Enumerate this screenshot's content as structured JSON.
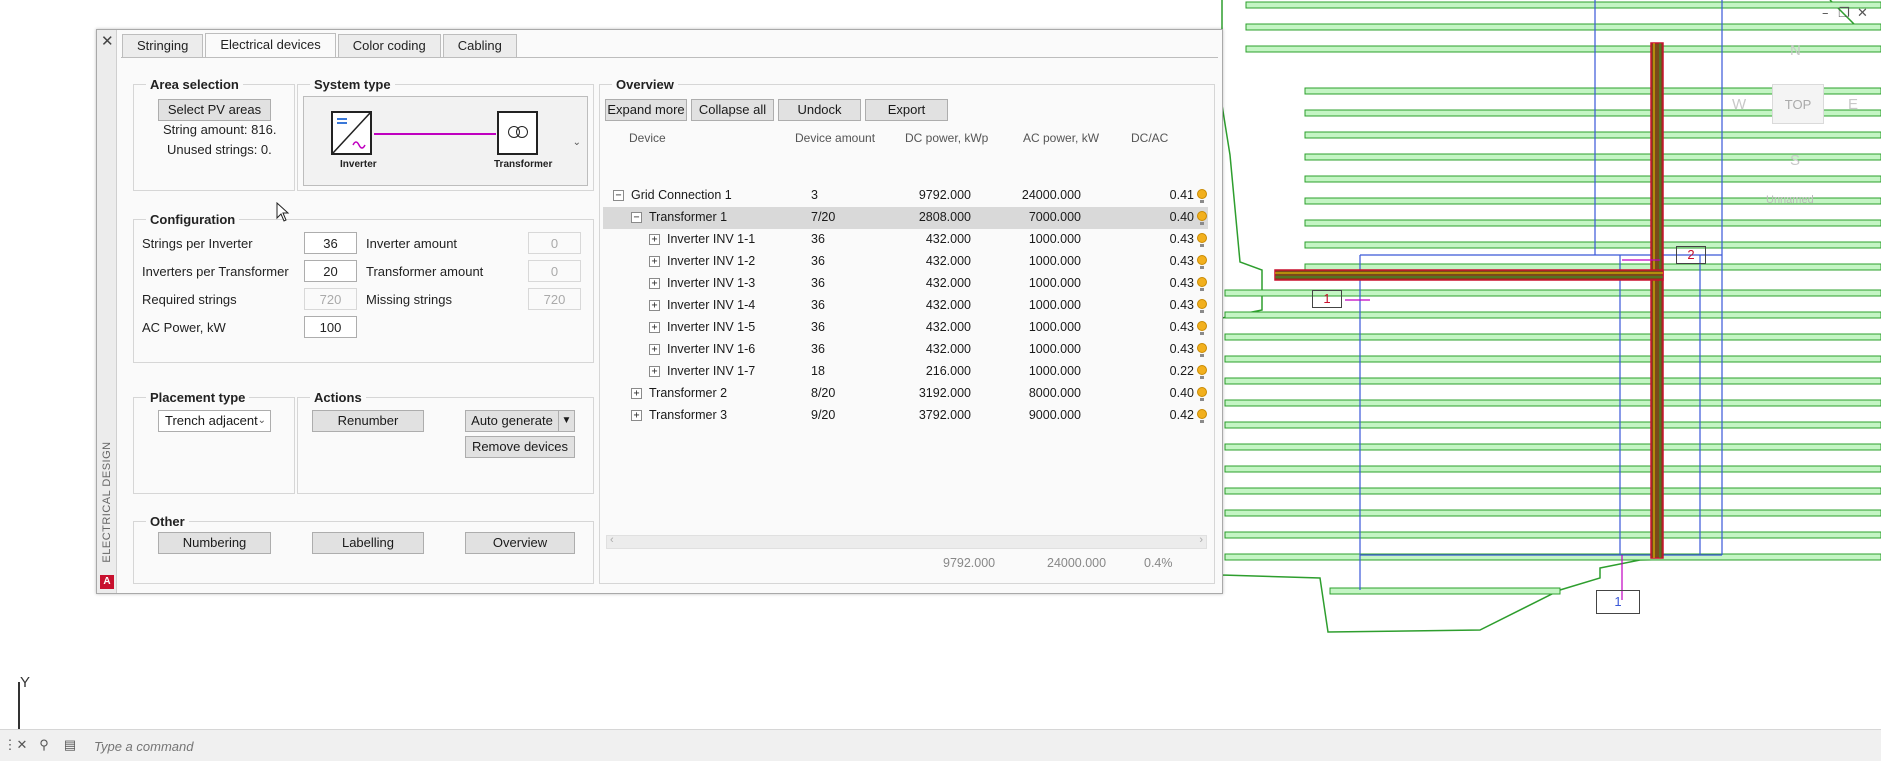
{
  "cad": {
    "viewcube": {
      "north": "N",
      "west": "W",
      "east": "E",
      "south": "S",
      "top": "TOP",
      "wcs": "Unnamed"
    },
    "ucs": {
      "y_label": "Y"
    },
    "markers": [
      "1",
      "2",
      "1"
    ],
    "colors": {
      "panels": "#2ca02c",
      "panel_fill": "#c4f5c4",
      "blue_lines": "#3a58d8",
      "trench": "#c8102e",
      "boundary": "#2e9e2e",
      "cable_magenta": "#c000c0"
    }
  },
  "palette": {
    "side_title": "ELECTRICAL DESIGN",
    "logo": "A",
    "tabs": [
      {
        "label": "Stringing"
      },
      {
        "label": "Electrical devices"
      },
      {
        "label": "Color coding"
      },
      {
        "label": "Cabling"
      }
    ],
    "area_selection": {
      "title": "Area selection",
      "button": "Select PV areas",
      "string_amount": "String amount: 816.",
      "unused_strings": "Unused strings: 0."
    },
    "system_type": {
      "title": "System type",
      "inverter_label": "Inverter",
      "transformer_label": "Transformer"
    },
    "configuration": {
      "title": "Configuration",
      "strings_per_inverter_label": "Strings per Inverter",
      "strings_per_inverter": "36",
      "inverter_amount_label": "Inverter amount",
      "inverter_amount": "0",
      "inverters_per_transformer_label": "Inverters per Transformer",
      "inverters_per_transformer": "20",
      "transformer_amount_label": "Transformer amount",
      "transformer_amount": "0",
      "required_strings_label": "Required strings",
      "required_strings": "720",
      "missing_strings_label": "Missing strings",
      "missing_strings": "720",
      "ac_power_label": "AC Power, kW",
      "ac_power": "100"
    },
    "placement": {
      "title": "Placement type",
      "value": "Trench adjacent"
    },
    "actions": {
      "title": "Actions",
      "renumber": "Renumber",
      "auto_generate": "Auto generate",
      "remove_devices": "Remove devices"
    },
    "other": {
      "title": "Other",
      "numbering": "Numbering",
      "labelling": "Labelling",
      "overview": "Overview"
    },
    "overview": {
      "title": "Overview",
      "buttons": {
        "expand_more": "Expand more",
        "collapse_all": "Collapse all",
        "undock": "Undock",
        "export": "Export"
      },
      "columns": {
        "device": "Device",
        "amount": "Device amount",
        "dc": "DC power, kWp",
        "ac": "AC power, kW",
        "ratio": "DC/AC"
      },
      "rows": [
        {
          "name": "Grid Connection 1",
          "amount": "3",
          "dc": "9792.000",
          "ac": "24000.000",
          "ratio": "0.41",
          "level": 0,
          "sign": "−"
        },
        {
          "name": "Transformer 1",
          "amount": "7/20",
          "dc": "2808.000",
          "ac": "7000.000",
          "ratio": "0.40",
          "level": 1,
          "sign": "−"
        },
        {
          "name": "Inverter INV 1-1",
          "amount": "36",
          "dc": "432.000",
          "ac": "1000.000",
          "ratio": "0.43",
          "level": 2,
          "sign": "+"
        },
        {
          "name": "Inverter INV 1-2",
          "amount": "36",
          "dc": "432.000",
          "ac": "1000.000",
          "ratio": "0.43",
          "level": 2,
          "sign": "+"
        },
        {
          "name": "Inverter INV 1-3",
          "amount": "36",
          "dc": "432.000",
          "ac": "1000.000",
          "ratio": "0.43",
          "level": 2,
          "sign": "+"
        },
        {
          "name": "Inverter INV 1-4",
          "amount": "36",
          "dc": "432.000",
          "ac": "1000.000",
          "ratio": "0.43",
          "level": 2,
          "sign": "+"
        },
        {
          "name": "Inverter INV 1-5",
          "amount": "36",
          "dc": "432.000",
          "ac": "1000.000",
          "ratio": "0.43",
          "level": 2,
          "sign": "+"
        },
        {
          "name": "Inverter INV 1-6",
          "amount": "36",
          "dc": "432.000",
          "ac": "1000.000",
          "ratio": "0.43",
          "level": 2,
          "sign": "+"
        },
        {
          "name": "Inverter INV 1-7",
          "amount": "18",
          "dc": "216.000",
          "ac": "1000.000",
          "ratio": "0.22",
          "level": 2,
          "sign": "+"
        },
        {
          "name": "Transformer 2",
          "amount": "8/20",
          "dc": "3192.000",
          "ac": "8000.000",
          "ratio": "0.40",
          "level": 1,
          "sign": "+"
        },
        {
          "name": "Transformer 3",
          "amount": "9/20",
          "dc": "3792.000",
          "ac": "9000.000",
          "ratio": "0.42",
          "level": 1,
          "sign": "+"
        }
      ],
      "totals": {
        "dc": "9792.000",
        "ac": "24000.000",
        "ratio": "0.4%"
      }
    }
  },
  "command_line": {
    "placeholder": "Type a command"
  }
}
